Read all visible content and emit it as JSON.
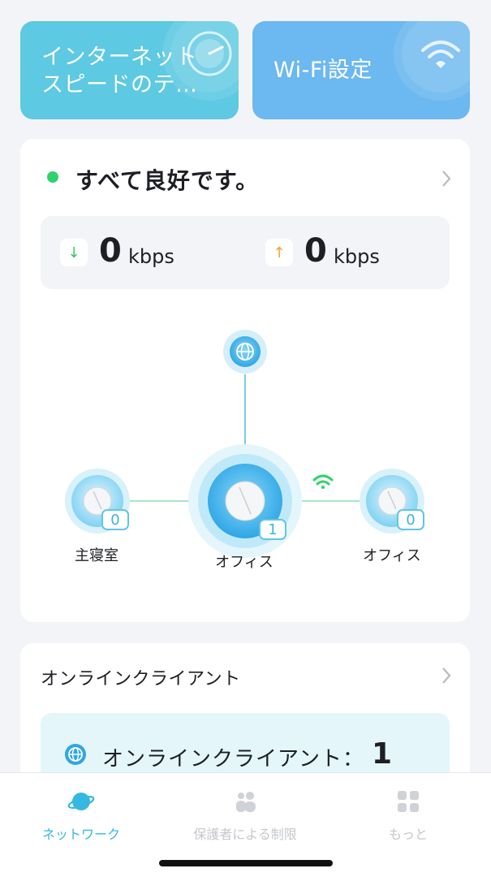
{
  "tiles": {
    "speed_test": "インターネット\nスピードのテ…",
    "wifi_settings": "Wi-Fi設定"
  },
  "status": {
    "text": "すべて良好です。",
    "download_value": "0",
    "download_unit": "kbps",
    "upload_value": "0",
    "upload_unit": "kbps",
    "dot_color": "#2fd26a"
  },
  "topology": {
    "nodes": {
      "left": {
        "name": "主寝室",
        "count": "0"
      },
      "center": {
        "name": "オフィス",
        "count": "1"
      },
      "right": {
        "name": "オフィス",
        "count": "0"
      }
    }
  },
  "clients": {
    "title": "オンラインクライアント",
    "label": "オンラインクライアント：",
    "count": "1"
  },
  "tabbar": {
    "network": "ネットワーク",
    "parental": "保護者による制限",
    "more": "もっと"
  },
  "colors": {
    "accent": "#34b8e0",
    "status_green": "#2fd26a"
  }
}
